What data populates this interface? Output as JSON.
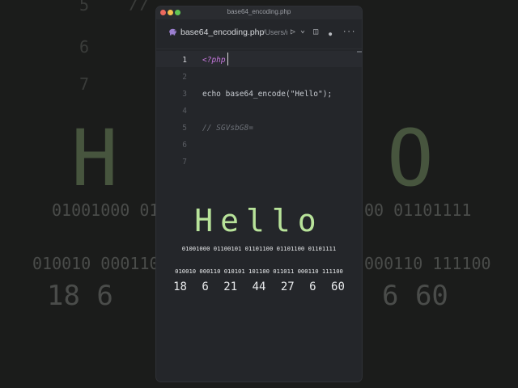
{
  "window": {
    "title": "base64_encoding.php"
  },
  "tab": {
    "icon": "php-elephant-icon",
    "filename": "base64_encoding.php",
    "path": "/Users/r"
  },
  "toolbar": {
    "run_icon": "▷",
    "dropdown_icon": "⌄",
    "split_icon": "◫",
    "dot_icon": "●",
    "more_icon": "···"
  },
  "editor": {
    "line_numbers": [
      "1",
      "2",
      "3",
      "4",
      "5",
      "6",
      "7"
    ],
    "line1": "<?php",
    "line3_echo": "echo ",
    "line3_fn": "base64_encode(",
    "line3_str": "\"Hello\"",
    "line3_end": ");",
    "line5_comment": "// SGVsbG8="
  },
  "overlay": {
    "word": "Hello",
    "bits8": "01001000 01100101 01101100 01101100 01101111",
    "bits6": "010010 000110 010101 101100 011011 000110 111100",
    "numbers": [
      "18",
      "6",
      "21",
      "44",
      "27",
      "6",
      "60"
    ]
  },
  "background": {
    "line_numbers": [
      "5",
      "6",
      "7"
    ],
    "comment": "//",
    "h": "H",
    "o": "O",
    "bits8_left": "01001000 01",
    "bits8_right": "00 01101111",
    "bits6_left": "010010 000110",
    "bits6_right": "000110 111100",
    "nums_left": "18   6",
    "nums_right": "6   60"
  },
  "colors": {
    "accent_green": "#b8e39a",
    "keyword": "#c678dd",
    "string": "#e5c07b"
  }
}
